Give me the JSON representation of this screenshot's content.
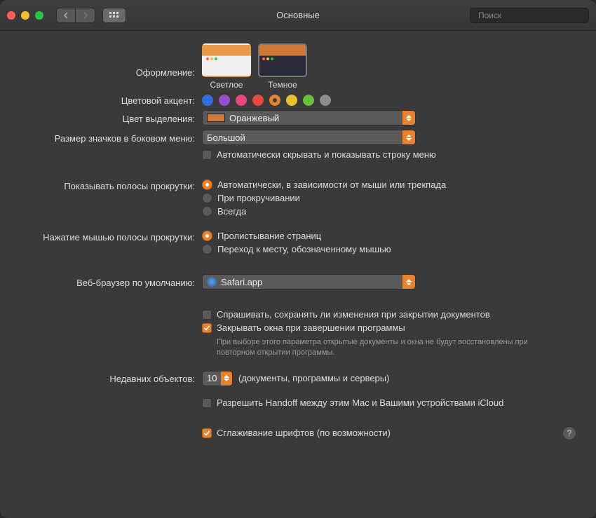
{
  "title": "Основные",
  "search_placeholder": "Поиск",
  "appearance": {
    "label": "Оформление:",
    "options": [
      {
        "id": "light",
        "caption": "Светлое"
      },
      {
        "id": "dark",
        "caption": "Темное"
      }
    ],
    "selected": "dark"
  },
  "accent": {
    "label": "Цветовой акцент:",
    "colors": [
      "#2f6fe0",
      "#9a4dce",
      "#e8467c",
      "#e84a3e",
      "#e8822d",
      "#e8c22d",
      "#6bbf3a",
      "#8e8e8e"
    ],
    "selected_index": 4
  },
  "highlight": {
    "label": "Цвет выделения:",
    "value": "Оранжевый"
  },
  "sidebar_icon": {
    "label": "Размер значков в боковом меню:",
    "value": "Большой"
  },
  "menubar_autohide": {
    "label": "Автоматически скрывать и показывать строку меню",
    "checked": false
  },
  "scrollbars": {
    "label": "Показывать полосы прокрутки:",
    "options": [
      "Автоматически, в зависимости от мыши или трекпада",
      "При прокручивании",
      "Всегда"
    ],
    "selected_index": 0
  },
  "scrollbar_click": {
    "label": "Нажатие мышью полосы прокрутки:",
    "options": [
      "Пролистывание страниц",
      "Переход к месту, обозначенному мышью"
    ],
    "selected_index": 0
  },
  "default_browser": {
    "label": "Веб-браузер по умолчанию:",
    "value": "Safari.app"
  },
  "ask_save": {
    "label": "Спрашивать, сохранять ли изменения при закрытии документов",
    "checked": false
  },
  "close_windows": {
    "label": "Закрывать окна при завершении программы",
    "hint": "При выборе этого параметра открытые документы и окна не будут восстановлены при повторном открытии программы.",
    "checked": true
  },
  "recent_items": {
    "label": "Недавних объектов:",
    "value": "10",
    "suffix": "(документы, программы и серверы)"
  },
  "handoff": {
    "label": "Разрешить Handoff между этим Mac и Вашими устройствами iCloud",
    "checked": false
  },
  "font_smoothing": {
    "label": "Сглаживание шрифтов (по возможности)",
    "checked": true
  }
}
